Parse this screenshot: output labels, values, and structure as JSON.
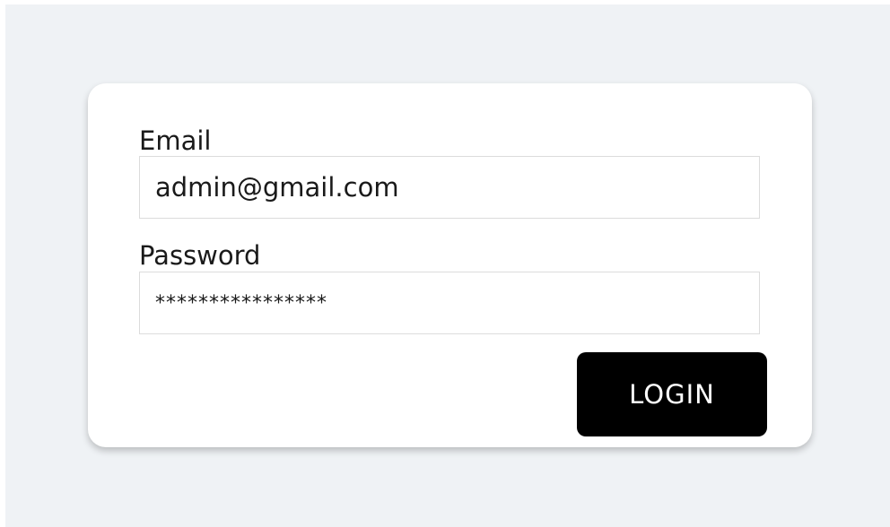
{
  "login_form": {
    "email": {
      "label": "Email",
      "value": "admin@gmail.com"
    },
    "password": {
      "label": "Password",
      "value": "****************"
    },
    "submit_label": "LOGIN"
  },
  "colors": {
    "page_background": "#eff2f5",
    "card_background": "#ffffff",
    "button_background": "#000000",
    "button_text": "#ffffff",
    "field_border": "#dcdcdc"
  }
}
